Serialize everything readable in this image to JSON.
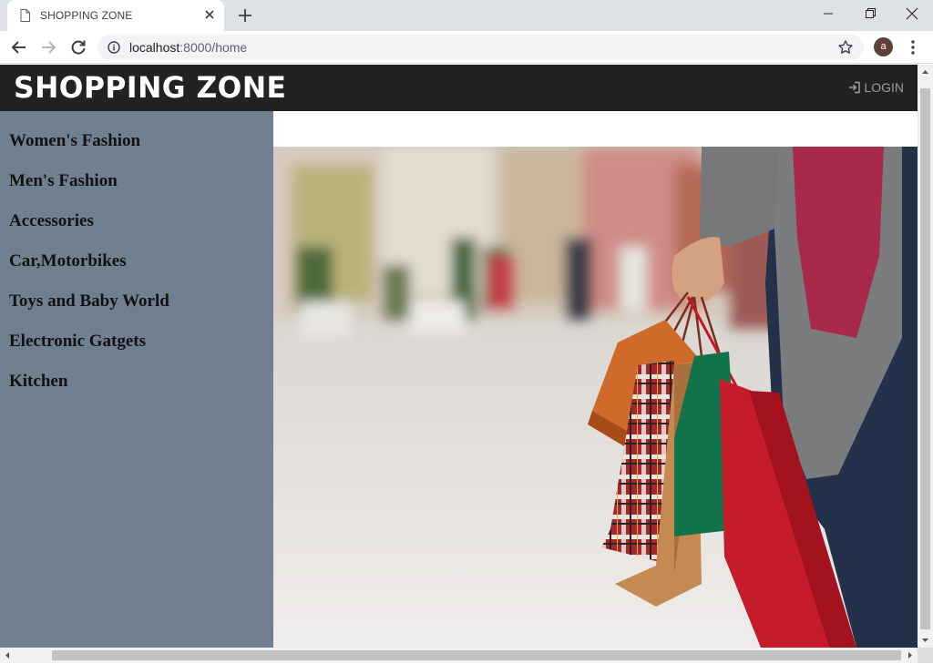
{
  "browser": {
    "tab_title": "SHOPPING ZONE",
    "url_host": "localhost",
    "url_path": ":8000/home",
    "profile_initial": "a"
  },
  "page": {
    "brand": "SHOPPING ZONE",
    "login_label": "LOGIN",
    "categories": [
      {
        "label": "Women's Fashion"
      },
      {
        "label": "Men's Fashion"
      },
      {
        "label": "Accessories"
      },
      {
        "label": "Car,Motorbikes"
      },
      {
        "label": "Toys and Baby World"
      },
      {
        "label": "Electronic Gatgets"
      },
      {
        "label": "Kitchen"
      }
    ]
  },
  "colors": {
    "navbar": "#222222",
    "sidebar": "#708090",
    "login_text": "#9d9d9d"
  },
  "icons": [
    "page-icon",
    "close-icon",
    "plus-icon",
    "back-icon",
    "forward-icon",
    "reload-icon",
    "info-icon",
    "star-icon",
    "menu-icon",
    "login-icon"
  ]
}
